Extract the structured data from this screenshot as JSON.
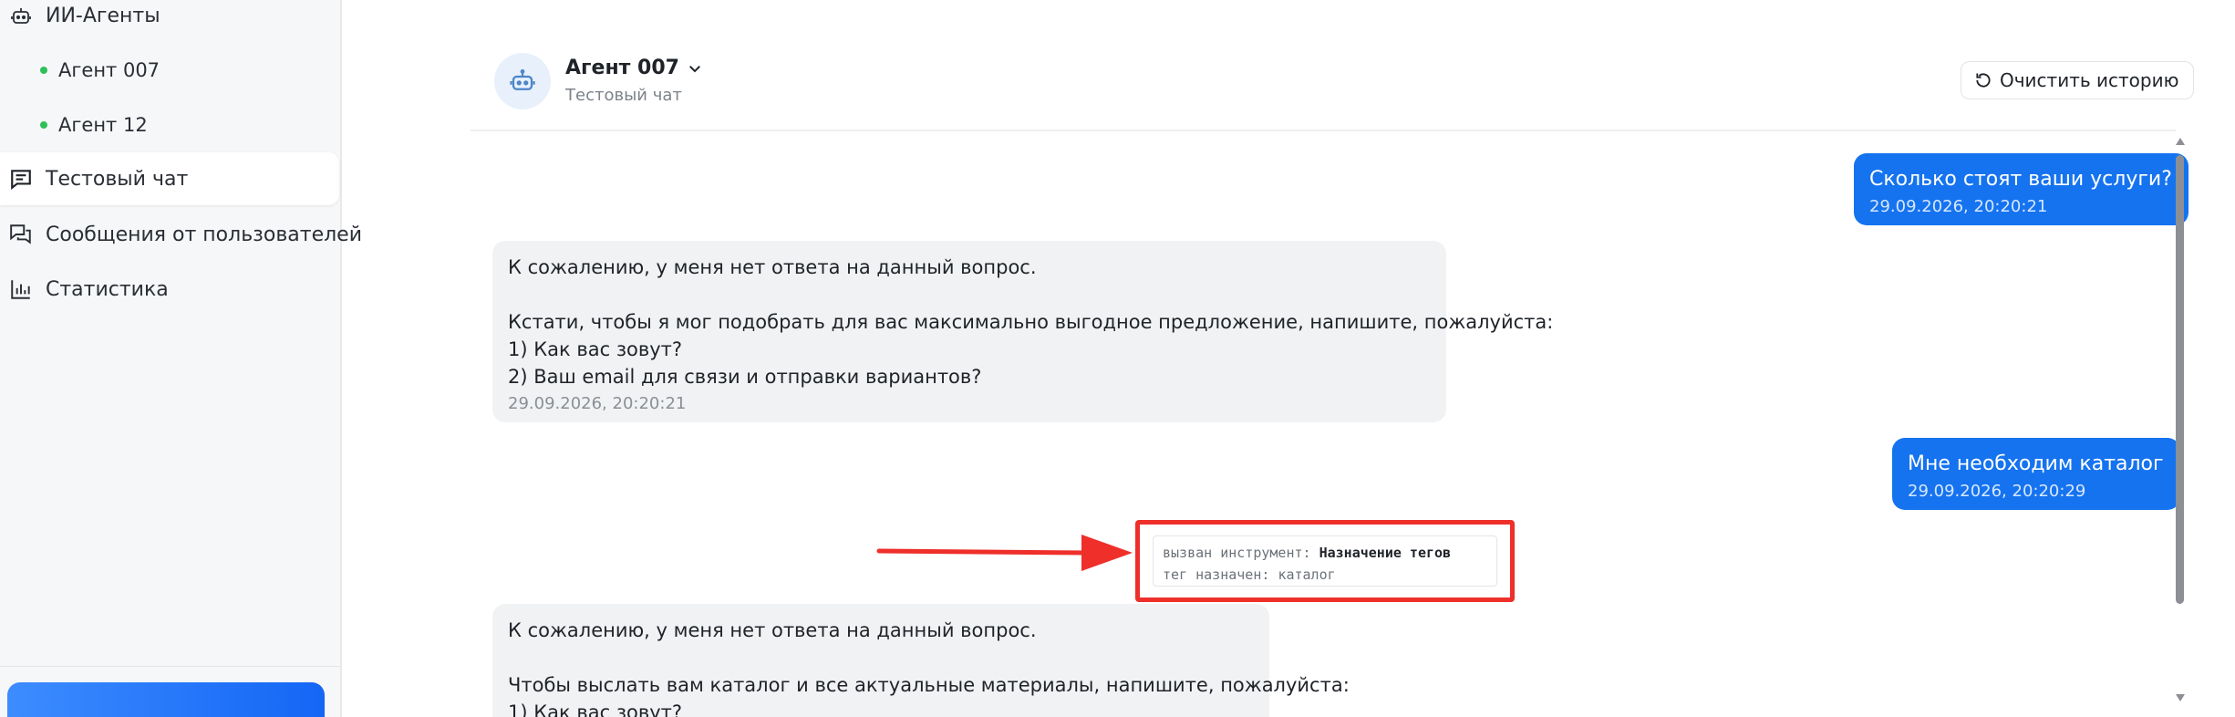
{
  "sidebar": {
    "section_title": "ИИ-Агенты",
    "agents": [
      {
        "label": "Агент 007"
      },
      {
        "label": "Агент 12"
      }
    ],
    "items": [
      {
        "label": "Тестовый чат",
        "icon": "chat-icon",
        "active": true
      },
      {
        "label": "Сообщения от пользователей",
        "icon": "messages-icon",
        "active": false
      },
      {
        "label": "Статистика",
        "icon": "stats-icon",
        "active": false
      }
    ]
  },
  "header": {
    "agent_name": "Агент 007",
    "subtitle": "Тестовый чат",
    "clear_button": "Очистить историю"
  },
  "messages": [
    {
      "role": "user",
      "text": "Сколько стоят ваши услуги?",
      "time": "29.09.2026, 20:20:21"
    },
    {
      "role": "bot",
      "lines": [
        "К сожалению, у меня нет ответа на данный вопрос.",
        "",
        "Кстати, чтобы я мог подобрать для вас максимально выгодное предложение, напишите, пожалуйста:",
        "1) Как вас зовут?",
        "2) Ваш email для связи и отправки вариантов?"
      ],
      "time": "29.09.2026, 20:20:21"
    },
    {
      "role": "user",
      "text": "Мне необходим каталог",
      "time": "29.09.2026, 20:20:29"
    },
    {
      "role": "tool",
      "called_label": "вызван инструмент:",
      "tool_name": "Назначение тегов",
      "tag_label": "тег назначен:",
      "tag_value": "каталог"
    },
    {
      "role": "bot",
      "lines": [
        "К сожалению, у меня нет ответа на данный вопрос.",
        "",
        "Чтобы выслать вам каталог и все актуальные материалы, напишите, пожалуйста:",
        "1) Как вас зовут?"
      ]
    }
  ],
  "colors": {
    "accent": "#1573f0",
    "online_dot": "#2fbf5a",
    "highlight_box": "#ee2f2a",
    "bot_bubble": "#f1f2f4"
  }
}
